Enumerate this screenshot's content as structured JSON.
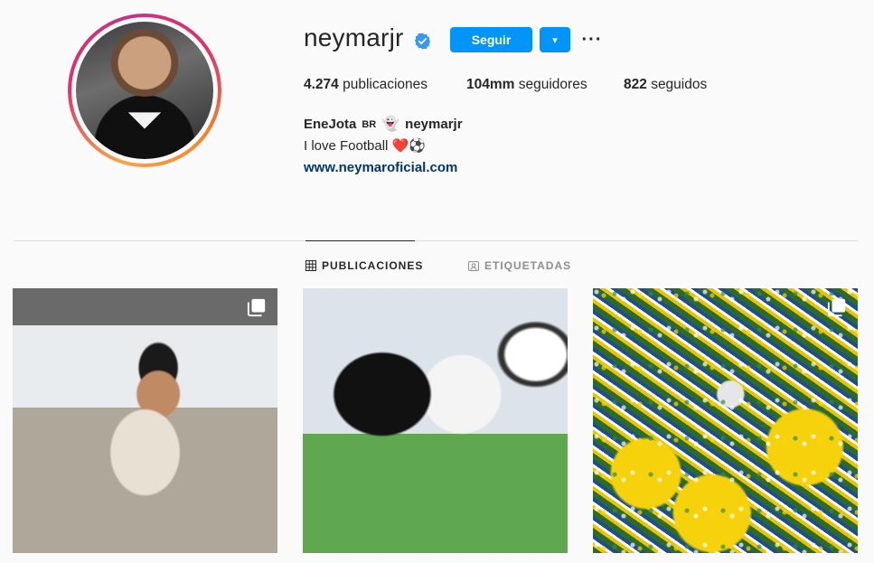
{
  "profile": {
    "username": "neymarjr",
    "follow_label": "Seguir",
    "dropdown_glyph": "▾",
    "more_glyph": "···",
    "stats": {
      "posts_count": "4.274",
      "posts_label": "publicaciones",
      "followers_count": "104mm",
      "followers_label": "seguidores",
      "following_count": "822",
      "following_label": "seguidos"
    },
    "bio": {
      "name": "EneJota",
      "flag_text": "BR",
      "ghost_glyph": "👻",
      "handle": "neymarjr",
      "text": "I love Football ❤️⚽",
      "link": "www.neymaroficial.com"
    }
  },
  "tabs": [
    {
      "label": "PUBLICACIONES",
      "icon": "grid-icon",
      "active": true
    },
    {
      "label": "ETIQUETADAS",
      "icon": "tagged-icon",
      "active": false
    }
  ],
  "colors": {
    "accent": "#0095f6",
    "background": "#fafafa",
    "link": "#00376b",
    "verified": "#3897f0"
  },
  "posts": [
    {
      "icon": "multiple-photos-icon"
    },
    {
      "icon": "none"
    },
    {
      "icon": "multiple-photos-icon"
    }
  ]
}
